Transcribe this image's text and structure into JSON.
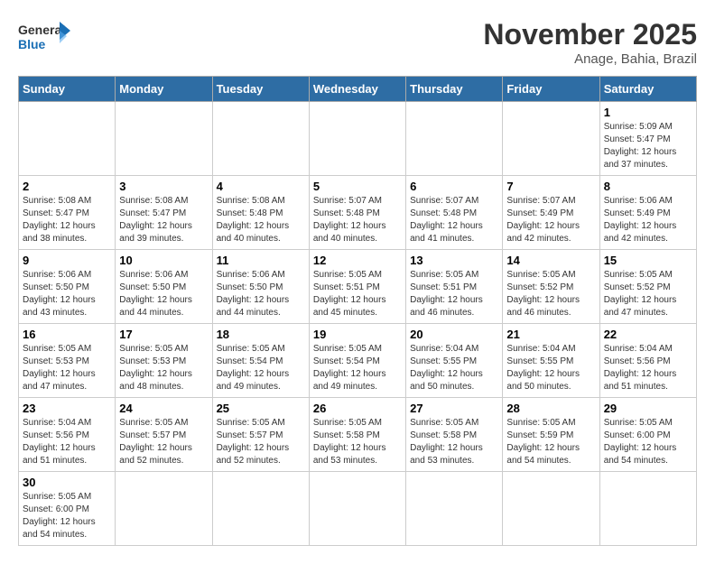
{
  "header": {
    "logo_general": "General",
    "logo_blue": "Blue",
    "month_title": "November 2025",
    "location": "Anage, Bahia, Brazil"
  },
  "weekdays": [
    "Sunday",
    "Monday",
    "Tuesday",
    "Wednesday",
    "Thursday",
    "Friday",
    "Saturday"
  ],
  "days": [
    {
      "date": "",
      "info": ""
    },
    {
      "date": "",
      "info": ""
    },
    {
      "date": "",
      "info": ""
    },
    {
      "date": "",
      "info": ""
    },
    {
      "date": "",
      "info": ""
    },
    {
      "date": "",
      "info": ""
    },
    {
      "date": "1",
      "info": "Sunrise: 5:09 AM\nSunset: 5:47 PM\nDaylight: 12 hours and 37 minutes."
    },
    {
      "date": "2",
      "info": "Sunrise: 5:08 AM\nSunset: 5:47 PM\nDaylight: 12 hours and 38 minutes."
    },
    {
      "date": "3",
      "info": "Sunrise: 5:08 AM\nSunset: 5:47 PM\nDaylight: 12 hours and 39 minutes."
    },
    {
      "date": "4",
      "info": "Sunrise: 5:08 AM\nSunset: 5:48 PM\nDaylight: 12 hours and 40 minutes."
    },
    {
      "date": "5",
      "info": "Sunrise: 5:07 AM\nSunset: 5:48 PM\nDaylight: 12 hours and 40 minutes."
    },
    {
      "date": "6",
      "info": "Sunrise: 5:07 AM\nSunset: 5:48 PM\nDaylight: 12 hours and 41 minutes."
    },
    {
      "date": "7",
      "info": "Sunrise: 5:07 AM\nSunset: 5:49 PM\nDaylight: 12 hours and 42 minutes."
    },
    {
      "date": "8",
      "info": "Sunrise: 5:06 AM\nSunset: 5:49 PM\nDaylight: 12 hours and 42 minutes."
    },
    {
      "date": "9",
      "info": "Sunrise: 5:06 AM\nSunset: 5:50 PM\nDaylight: 12 hours and 43 minutes."
    },
    {
      "date": "10",
      "info": "Sunrise: 5:06 AM\nSunset: 5:50 PM\nDaylight: 12 hours and 44 minutes."
    },
    {
      "date": "11",
      "info": "Sunrise: 5:06 AM\nSunset: 5:50 PM\nDaylight: 12 hours and 44 minutes."
    },
    {
      "date": "12",
      "info": "Sunrise: 5:05 AM\nSunset: 5:51 PM\nDaylight: 12 hours and 45 minutes."
    },
    {
      "date": "13",
      "info": "Sunrise: 5:05 AM\nSunset: 5:51 PM\nDaylight: 12 hours and 46 minutes."
    },
    {
      "date": "14",
      "info": "Sunrise: 5:05 AM\nSunset: 5:52 PM\nDaylight: 12 hours and 46 minutes."
    },
    {
      "date": "15",
      "info": "Sunrise: 5:05 AM\nSunset: 5:52 PM\nDaylight: 12 hours and 47 minutes."
    },
    {
      "date": "16",
      "info": "Sunrise: 5:05 AM\nSunset: 5:53 PM\nDaylight: 12 hours and 47 minutes."
    },
    {
      "date": "17",
      "info": "Sunrise: 5:05 AM\nSunset: 5:53 PM\nDaylight: 12 hours and 48 minutes."
    },
    {
      "date": "18",
      "info": "Sunrise: 5:05 AM\nSunset: 5:54 PM\nDaylight: 12 hours and 49 minutes."
    },
    {
      "date": "19",
      "info": "Sunrise: 5:05 AM\nSunset: 5:54 PM\nDaylight: 12 hours and 49 minutes."
    },
    {
      "date": "20",
      "info": "Sunrise: 5:04 AM\nSunset: 5:55 PM\nDaylight: 12 hours and 50 minutes."
    },
    {
      "date": "21",
      "info": "Sunrise: 5:04 AM\nSunset: 5:55 PM\nDaylight: 12 hours and 50 minutes."
    },
    {
      "date": "22",
      "info": "Sunrise: 5:04 AM\nSunset: 5:56 PM\nDaylight: 12 hours and 51 minutes."
    },
    {
      "date": "23",
      "info": "Sunrise: 5:04 AM\nSunset: 5:56 PM\nDaylight: 12 hours and 51 minutes."
    },
    {
      "date": "24",
      "info": "Sunrise: 5:05 AM\nSunset: 5:57 PM\nDaylight: 12 hours and 52 minutes."
    },
    {
      "date": "25",
      "info": "Sunrise: 5:05 AM\nSunset: 5:57 PM\nDaylight: 12 hours and 52 minutes."
    },
    {
      "date": "26",
      "info": "Sunrise: 5:05 AM\nSunset: 5:58 PM\nDaylight: 12 hours and 53 minutes."
    },
    {
      "date": "27",
      "info": "Sunrise: 5:05 AM\nSunset: 5:58 PM\nDaylight: 12 hours and 53 minutes."
    },
    {
      "date": "28",
      "info": "Sunrise: 5:05 AM\nSunset: 5:59 PM\nDaylight: 12 hours and 54 minutes."
    },
    {
      "date": "29",
      "info": "Sunrise: 5:05 AM\nSunset: 6:00 PM\nDaylight: 12 hours and 54 minutes."
    },
    {
      "date": "30",
      "info": "Sunrise: 5:05 AM\nSunset: 6:00 PM\nDaylight: 12 hours and 54 minutes."
    },
    {
      "date": "",
      "info": ""
    },
    {
      "date": "",
      "info": ""
    },
    {
      "date": "",
      "info": ""
    },
    {
      "date": "",
      "info": ""
    },
    {
      "date": "",
      "info": ""
    },
    {
      "date": "",
      "info": ""
    }
  ]
}
